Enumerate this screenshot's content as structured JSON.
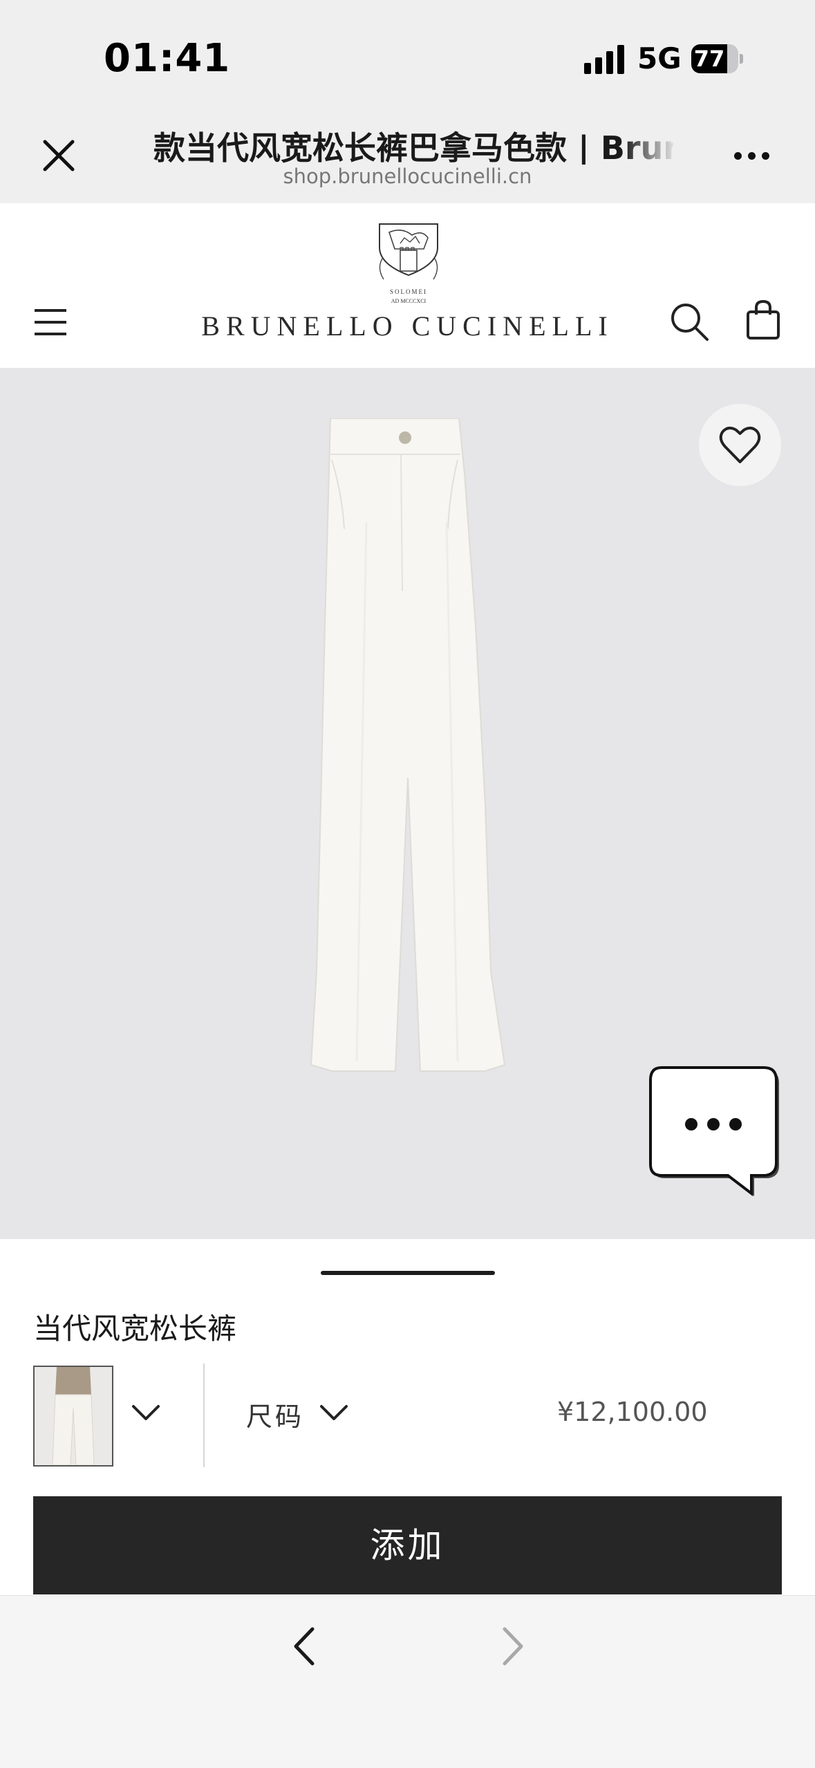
{
  "status_bar": {
    "time": "01:41",
    "network": "5G",
    "battery": "77",
    "battery_level": 0.77
  },
  "browser": {
    "title": "款当代风宽松长裤巴拿马色款 | Brunello Cucinelli",
    "url": "shop.brunellocucinelli.cn",
    "icons": {
      "close": "close-icon",
      "more": "more-icon",
      "back": "chevron-left-icon",
      "forward": "chevron-right-icon"
    }
  },
  "site_header": {
    "crest_motto": "SOLOMEI",
    "crest_year": "AD MCCCXCI",
    "brand": "BRUNELLO CUCINELLI",
    "icons": {
      "menu": "hamburger-icon",
      "search": "search-icon",
      "bag": "shopping-bag-icon"
    }
  },
  "product": {
    "name": "当代风宽松长裤",
    "size_label": "尺码",
    "price": "¥12,100.00",
    "add_button": "添加",
    "colors": {
      "product_bg": "#e6e5e7",
      "button_bg": "#262627",
      "pants": "#f7f6f2"
    }
  }
}
